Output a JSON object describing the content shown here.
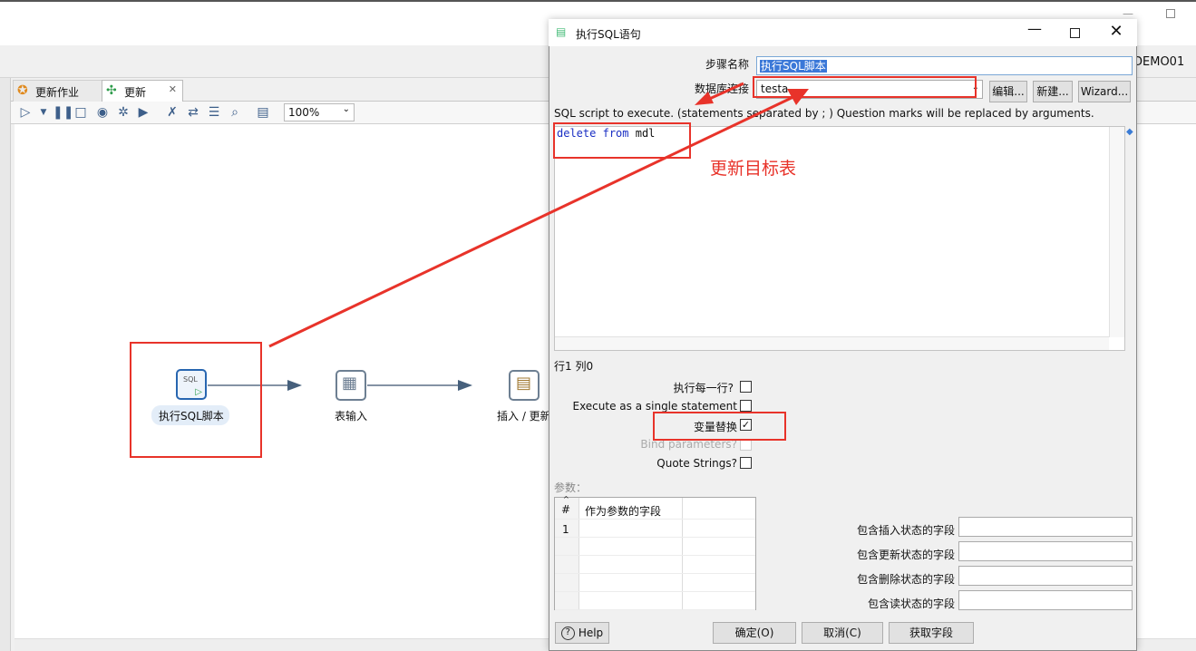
{
  "app": {
    "project_name": "DEMO01",
    "tabs": [
      {
        "label": "更新作业"
      },
      {
        "label": "更新"
      }
    ],
    "zoom": "100%"
  },
  "canvas": {
    "steps": [
      {
        "label": "执行SQL脚本",
        "icon": "sql-script-icon"
      },
      {
        "label": "表输入",
        "icon": "table-input-icon"
      },
      {
        "label": "插入 / 更新",
        "icon": "insert-update-icon"
      }
    ]
  },
  "dialog": {
    "title": "执行SQL语句",
    "step_name_label": "步骤名称",
    "step_name_value": "执行SQL脚本",
    "db_conn_label": "数据库连接",
    "db_conn_value": "testa",
    "edit_button": "编辑...",
    "new_button": "新建...",
    "wizard_button": "Wizard...",
    "sql_hint": "SQL script to execute. (statements separated by ; ) Question marks will be replaced by arguments.",
    "sql_keyword_1": "delete",
    "sql_keyword_2": "from",
    "sql_table": "mdl",
    "row_col": "行1 列0",
    "options": [
      {
        "label": "执行每一行?",
        "checked": false,
        "disabled": false
      },
      {
        "label": "Execute as a single statement",
        "checked": false,
        "disabled": false
      },
      {
        "label": "变量替换",
        "checked": true,
        "disabled": false
      },
      {
        "label": "Bind parameters?",
        "checked": false,
        "disabled": true
      },
      {
        "label": "Quote Strings?",
        "checked": false,
        "disabled": false
      }
    ],
    "params_label": "参数：",
    "params_table": {
      "columns": [
        "#",
        "作为参数的字段"
      ],
      "rows": [
        [
          "1",
          ""
        ]
      ]
    },
    "status_fields": [
      {
        "label": "包含插入状态的字段",
        "value": ""
      },
      {
        "label": "包含更新状态的字段",
        "value": ""
      },
      {
        "label": "包含删除状态的字段",
        "value": ""
      },
      {
        "label": "包含读状态的字段",
        "value": ""
      }
    ],
    "help_button": "Help",
    "ok_button": "确定(O)",
    "cancel_button": "取消(C)",
    "get_fields_button": "获取字段"
  },
  "annotation": {
    "text": "更新目标表",
    "color": "#e8332a"
  }
}
